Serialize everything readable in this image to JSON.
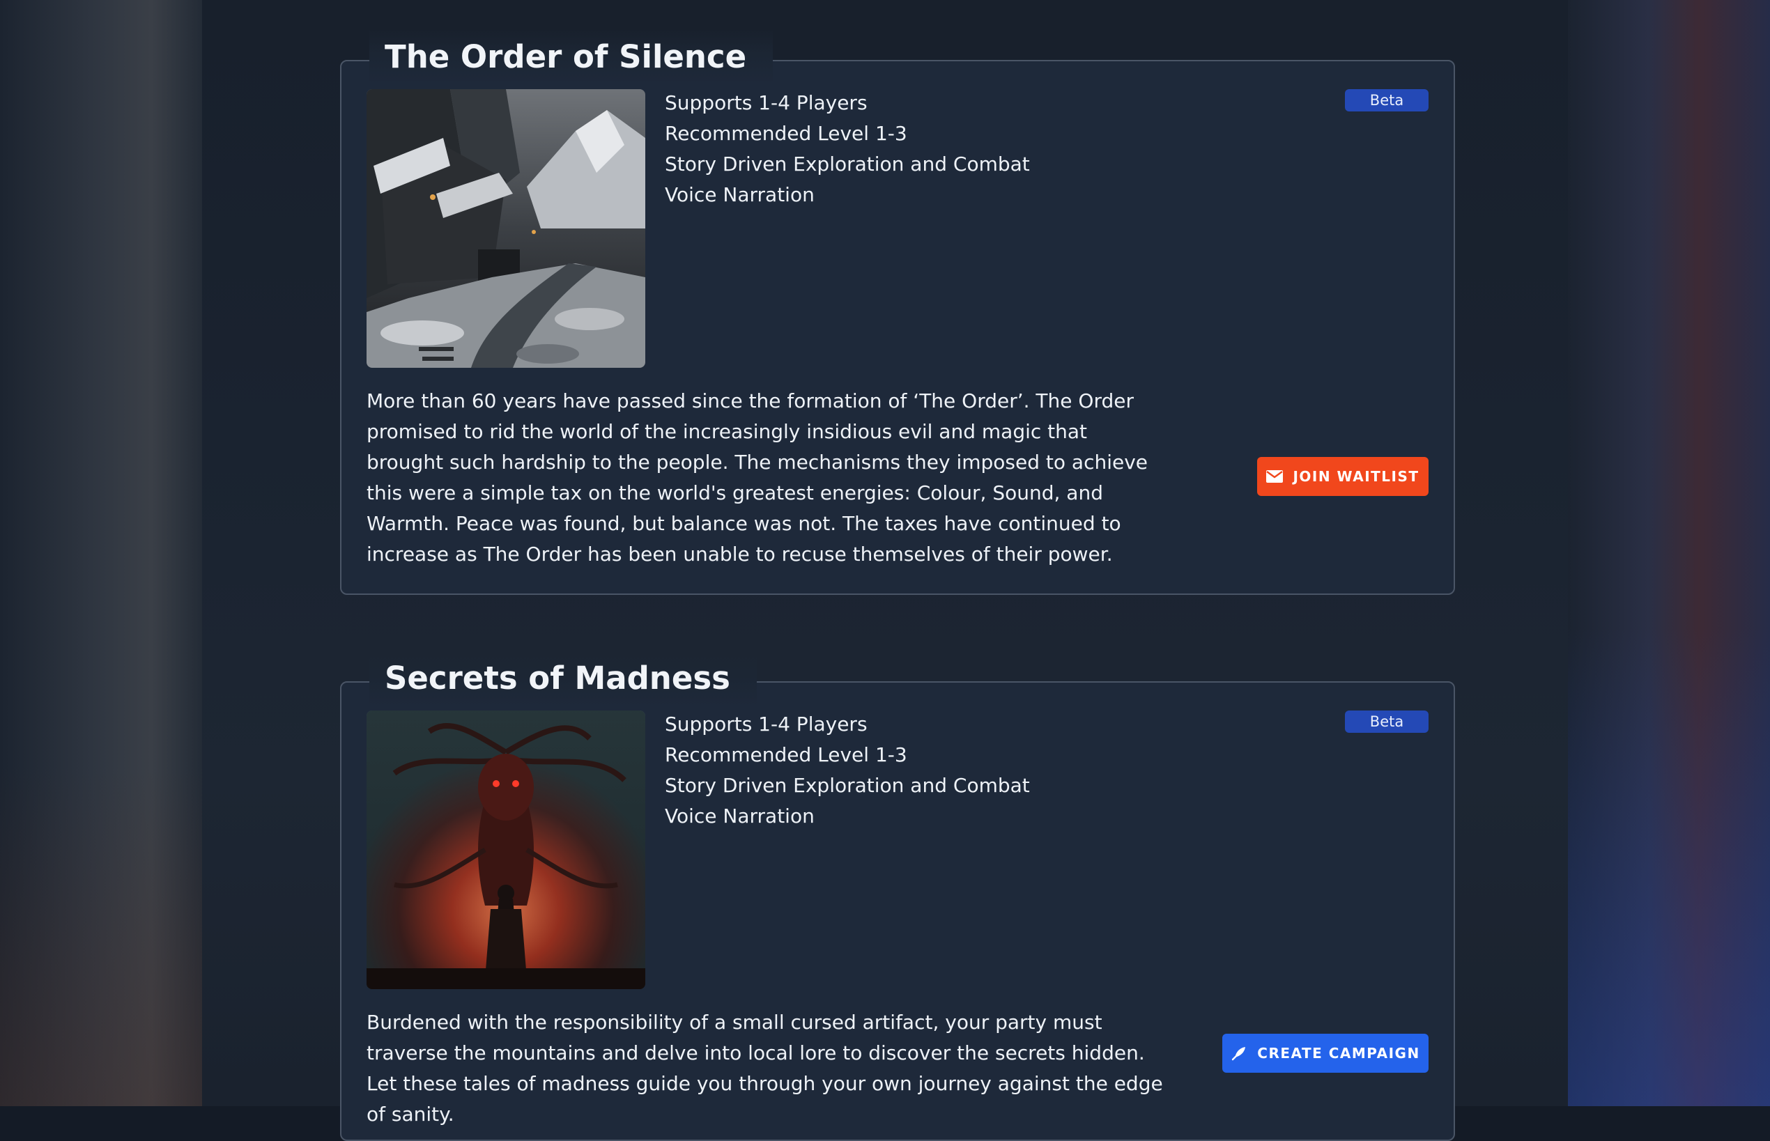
{
  "colors": {
    "page_background": "#141b26",
    "card_background": "#1e293a",
    "card_border": "#4a5566",
    "badge": "#2449b6",
    "waitlist_button": "#f1471c",
    "create_button": "#2463eb"
  },
  "campaigns": [
    {
      "title": "The Order of Silence",
      "badge": "Beta",
      "features": [
        "Supports 1-4 Players",
        "Recommended Level 1-3",
        "Story Driven Exploration and Combat",
        "Voice Narration"
      ],
      "description": "More than 60 years have passed since the formation of ‘The Order’. The Order promised to rid the world of the increasingly insidious evil and magic that brought such hardship to the people. The mechanisms they imposed to achieve this were a simple tax on the world's greatest energies: Colour, Sound, and Warmth. Peace was found, but balance was not. The taxes have continued to increase as The Order has been unable to recuse themselves of their power.",
      "action": {
        "label": "JOIN WAITLIST",
        "icon": "envelope-icon"
      }
    },
    {
      "title": "Secrets of Madness",
      "badge": "Beta",
      "features": [
        "Supports 1-4 Players",
        "Recommended Level 1-3",
        "Story Driven Exploration and Combat",
        "Voice Narration"
      ],
      "description": "Burdened with the responsibility of a small cursed artifact, your party must traverse the mountains and delve into local lore to discover the secrets hidden. Let these tales of madness guide you through your own journey against the edge of sanity.",
      "action": {
        "label": "CREATE CAMPAIGN",
        "icon": "quill-pen-icon"
      }
    }
  ]
}
